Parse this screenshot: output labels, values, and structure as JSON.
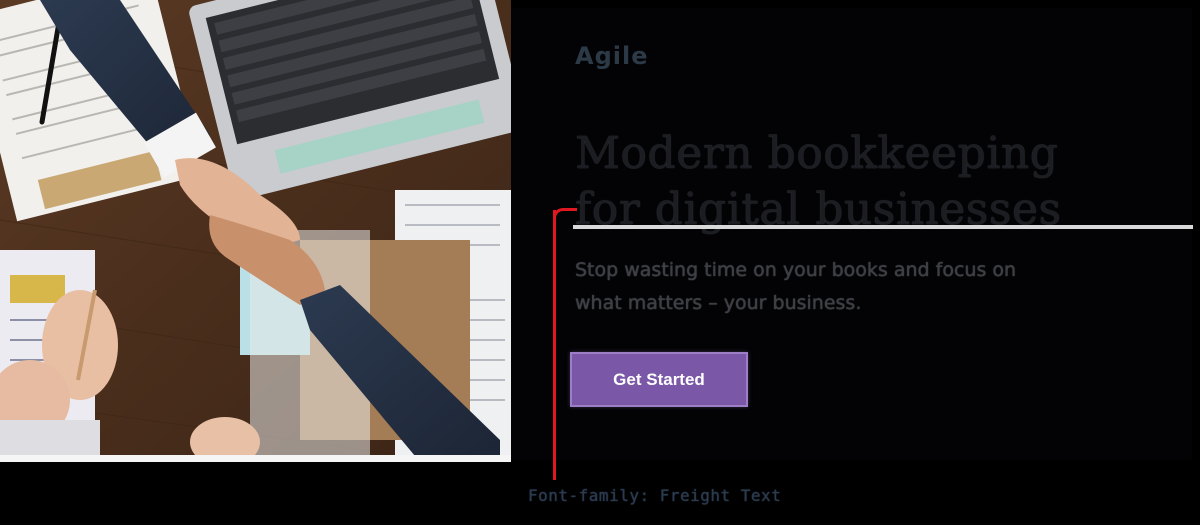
{
  "brand": {
    "logo_text": "Agile"
  },
  "hero": {
    "headline_line1": "Modern bookkeeping",
    "headline_line2": "for digital businesses",
    "subtitle_line1": "Stop wasting time on your books and focus on",
    "subtitle_line2": "what matters – your business.",
    "cta_label": "Get Started",
    "cta_color": "#7b57a8"
  },
  "footer": {
    "caption": "Font-family: Freight Text"
  },
  "colors": {
    "background": "#000000",
    "accent_red": "#e1181f",
    "headline": "#1b1d22"
  },
  "image": {
    "subject": "handshake-over-desk-photo"
  }
}
